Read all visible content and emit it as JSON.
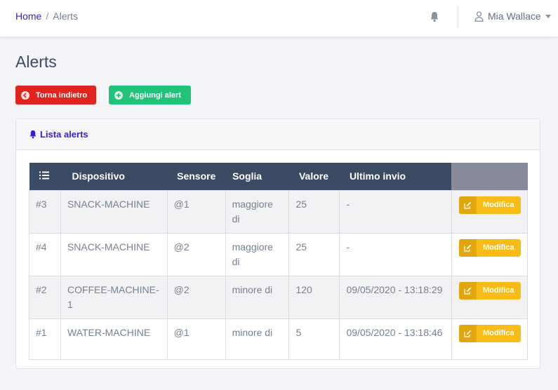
{
  "header": {
    "breadcrumb": {
      "home": "Home",
      "separator": "/",
      "current": "Alerts"
    },
    "user": {
      "name": "Mia Wallace"
    },
    "icons": {
      "notifications": "bell-icon",
      "user": "user-icon",
      "menu": "caret-down-icon"
    }
  },
  "page": {
    "title": "Alerts"
  },
  "actions": {
    "back_label": "Torna indietro",
    "add_label": "Aggiungi alert"
  },
  "card": {
    "title": "Lista alerts",
    "table": {
      "columns": [
        "Dispositivo",
        "Sensore",
        "Soglia",
        "Valore",
        "Ultimo invio"
      ],
      "rows": [
        {
          "id": "#3",
          "device": "SNACK-MACHINE",
          "sensor": "@1",
          "threshold": "maggiore di",
          "value": "25",
          "last_sent": "-",
          "action": "Modifica"
        },
        {
          "id": "#4",
          "device": "SNACK-MACHINE",
          "sensor": "@2",
          "threshold": "maggiore di",
          "value": "25",
          "last_sent": "-",
          "action": "Modifica"
        },
        {
          "id": "#2",
          "device": "COFFEE-MACHINE-1",
          "sensor": "@2",
          "threshold": "minore di",
          "value": "120",
          "last_sent": "09/05/2020 - 13:18:29",
          "action": "Modifica"
        },
        {
          "id": "#1",
          "device": "WATER-MACHINE",
          "sensor": "@1",
          "threshold": "minore di",
          "value": "5",
          "last_sent": "09/05/2020 - 13:18:46",
          "action": "Modifica"
        }
      ]
    }
  },
  "colors": {
    "primary": "#321fdb",
    "danger": "#e0241f",
    "success": "#1fc47a",
    "warning": "#f9bb16",
    "sensor": "#f9591e",
    "table_header": "#3c4b64"
  }
}
